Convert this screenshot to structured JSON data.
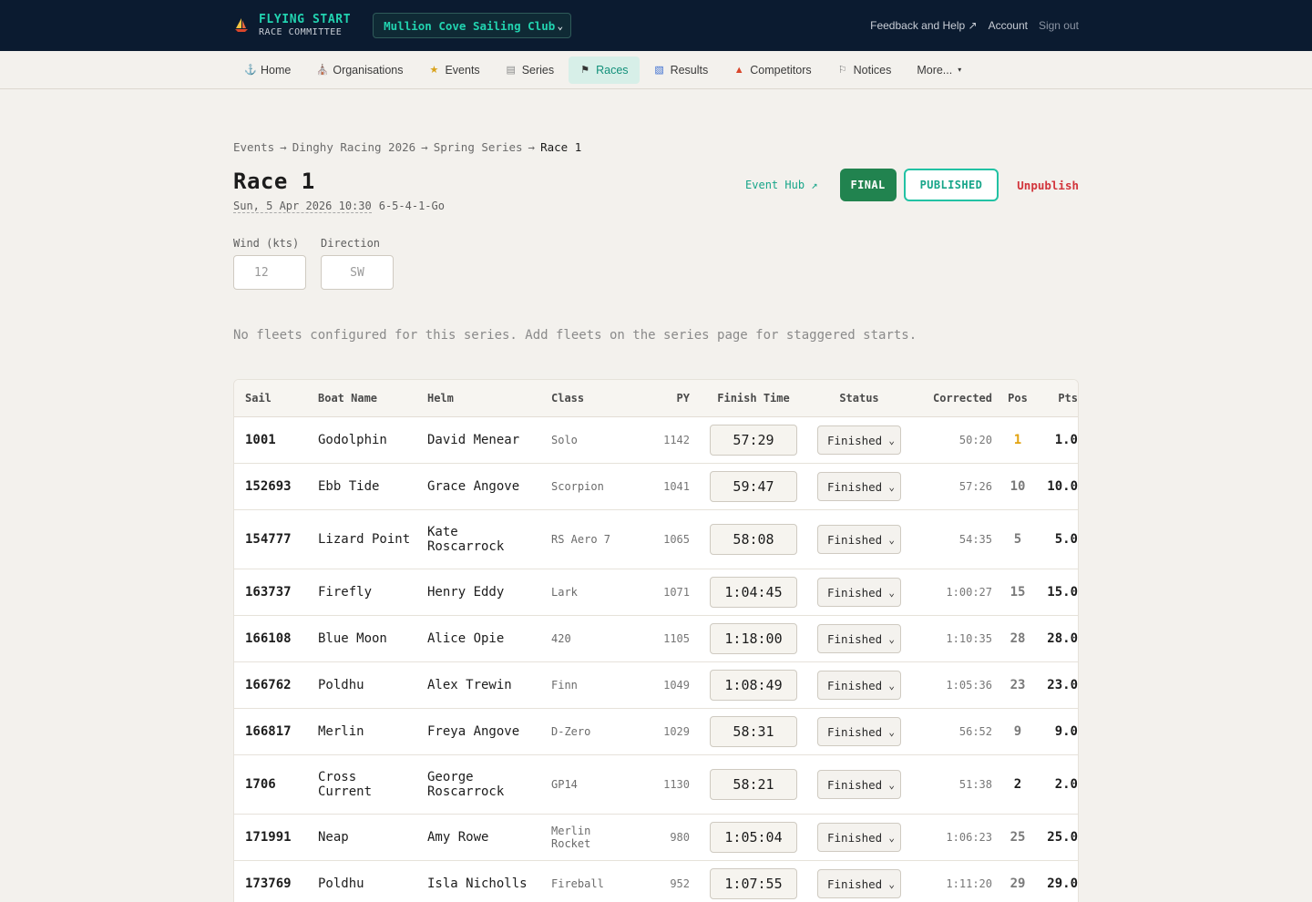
{
  "topbar": {
    "brand_title": "FLYING START",
    "brand_sub": "RACE COMMITTEE",
    "club": "Mullion Cove Sailing Club",
    "feedback": "Feedback and Help ↗",
    "account": "Account",
    "signout": "Sign out"
  },
  "nav": {
    "home": "Home",
    "organisations": "Organisations",
    "events": "Events",
    "series": "Series",
    "races": "Races",
    "results": "Results",
    "competitors": "Competitors",
    "notices": "Notices",
    "more": "More..."
  },
  "breadcrumb": {
    "b1": "Events",
    "b2": "Dinghy Racing 2026",
    "b3": "Spring Series",
    "b4": "Race 1",
    "sep": "→"
  },
  "race": {
    "title": "Race 1",
    "date": "Sun, 5 Apr 2026 10:30",
    "sequence": "6-5-4-1-Go",
    "event_hub": "Event Hub ↗",
    "final": "FINAL",
    "published": "PUBLISHED",
    "unpublish": "Unpublish"
  },
  "weather": {
    "wind_label": "Wind (kts)",
    "wind_placeholder": "12",
    "dir_label": "Direction",
    "dir_placeholder": "SW"
  },
  "notice": "No fleets configured for this series. Add fleets on the series page for staggered starts.",
  "table": {
    "headers": {
      "sail": "Sail",
      "boat": "Boat Name",
      "helm": "Helm",
      "class": "Class",
      "py": "PY",
      "finish": "Finish Time",
      "status": "Status",
      "corrected": "Corrected",
      "pos": "Pos",
      "pts": "Pts"
    },
    "rows": [
      {
        "sail": "1001",
        "boat": "Godolphin",
        "helm": "David Menear",
        "class": "Solo",
        "py": "1142",
        "finish": "57:29",
        "status": "Finished",
        "corrected": "50:20",
        "pos": "1",
        "pts": "1.0"
      },
      {
        "sail": "152693",
        "boat": "Ebb Tide",
        "helm": "Grace Angove",
        "class": "Scorpion",
        "py": "1041",
        "finish": "59:47",
        "status": "Finished",
        "corrected": "57:26",
        "pos": "10",
        "pts": "10.0"
      },
      {
        "sail": "154777",
        "boat": "Lizard Point",
        "helm": "Kate Roscarrock",
        "class": "RS Aero 7",
        "py": "1065",
        "finish": "58:08",
        "status": "Finished",
        "corrected": "54:35",
        "pos": "5",
        "pts": "5.0"
      },
      {
        "sail": "163737",
        "boat": "Firefly",
        "helm": "Henry Eddy",
        "class": "Lark",
        "py": "1071",
        "finish": "1:04:45",
        "status": "Finished",
        "corrected": "1:00:27",
        "pos": "15",
        "pts": "15.0"
      },
      {
        "sail": "166108",
        "boat": "Blue Moon",
        "helm": "Alice Opie",
        "class": "420",
        "py": "1105",
        "finish": "1:18:00",
        "status": "Finished",
        "corrected": "1:10:35",
        "pos": "28",
        "pts": "28.0"
      },
      {
        "sail": "166762",
        "boat": "Poldhu",
        "helm": "Alex Trewin",
        "class": "Finn",
        "py": "1049",
        "finish": "1:08:49",
        "status": "Finished",
        "corrected": "1:05:36",
        "pos": "23",
        "pts": "23.0"
      },
      {
        "sail": "166817",
        "boat": "Merlin",
        "helm": "Freya Angove",
        "class": "D-Zero",
        "py": "1029",
        "finish": "58:31",
        "status": "Finished",
        "corrected": "56:52",
        "pos": "9",
        "pts": "9.0"
      },
      {
        "sail": "1706",
        "boat": "Cross Current",
        "helm": "George Roscarrock",
        "class": "GP14",
        "py": "1130",
        "finish": "58:21",
        "status": "Finished",
        "corrected": "51:38",
        "pos": "2",
        "pts": "2.0"
      },
      {
        "sail": "171991",
        "boat": "Neap",
        "helm": "Amy Rowe",
        "class": "Merlin Rocket",
        "py": "980",
        "finish": "1:05:04",
        "status": "Finished",
        "corrected": "1:06:23",
        "pos": "25",
        "pts": "25.0"
      },
      {
        "sail": "173769",
        "boat": "Poldhu",
        "helm": "Isla Nicholls",
        "class": "Fireball",
        "py": "952",
        "finish": "1:07:55",
        "status": "Finished",
        "corrected": "1:11:20",
        "pos": "29",
        "pts": "29.0"
      }
    ]
  }
}
